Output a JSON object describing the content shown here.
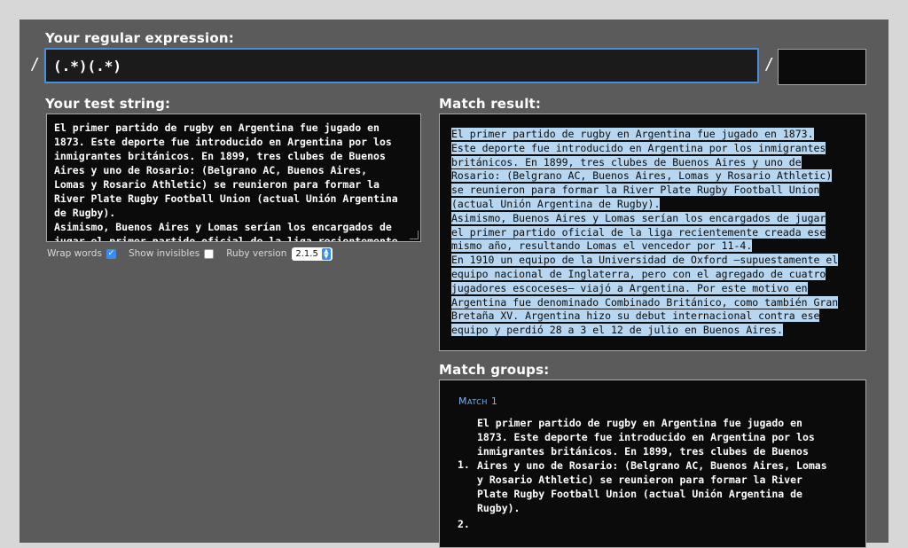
{
  "labels": {
    "regex": "Your regular expression:",
    "test": "Your test string:",
    "result": "Match result:",
    "groups": "Match groups:"
  },
  "regex": {
    "open_slash": "/",
    "close_slash": "/",
    "value": "(.*)(.*)",
    "flags": ""
  },
  "test_string": "El primer partido de rugby en Argentina fue jugado en\n1873. Este deporte fue introducido en Argentina por los\ninmigrantes británicos. En 1899, tres clubes de Buenos\nAires y uno de Rosario: (Belgrano AC, Buenos Aires,\nLomas y Rosario Athletic) se reunieron para formar la\nRiver Plate Rugby Football Union (actual Unión Argentina\nde Rugby).\nAsimismo, Buenos Aires y Lomas serían los encargados de\njugar el primer partido oficial de la liga recientemente",
  "options": {
    "wrap_words": "Wrap words",
    "wrap_words_checked": true,
    "show_invisibles": "Show invisibles",
    "show_invisibles_checked": false,
    "ruby_version_label": "Ruby version",
    "ruby_version": "2.1.5"
  },
  "match_result": [
    "El primer partido de rugby en Argentina fue jugado en 1873.",
    "Este deporte fue introducido en Argentina por los inmigrantes",
    "británicos. En 1899, tres clubes de Buenos Aires y uno de",
    "Rosario: (Belgrano AC, Buenos Aires, Lomas y Rosario Athletic)",
    "se reunieron para formar la River Plate Rugby Football Union",
    "(actual Unión Argentina de Rugby).",
    "Asimismo, Buenos Aires y Lomas serían los encargados de jugar",
    "el primer partido oficial de la liga recientemente creada ese",
    "mismo año, resultando Lomas el vencedor por 11-4.",
    "En 1910 un equipo de la Universidad de Oxford —supuestamente el",
    "equipo nacional de Inglaterra, pero con el agregado de cuatro",
    "jugadores escoceses— viajó a Argentina. Por este motivo en",
    "Argentina fue denominado Combinado Británico, como también Gran",
    "Bretaña XV. Argentina hizo su debut internacional contra ese",
    "equipo y perdió 28 a 3 el 12 de julio en Buenos Aires."
  ],
  "match_groups": {
    "match_title": "Match 1",
    "groups": [
      {
        "num": "1.",
        "value": "El primer partido de rugby en Argentina fue jugado en\n1873. Este deporte fue introducido en Argentina por los\ninmigrantes británicos. En 1899, tres clubes de Buenos\nAires y uno de Rosario: (Belgrano AC, Buenos Aires, Lomas\ny Rosario Athletic) se reunieron para formar la River\nPlate Rugby Football Union (actual Unión Argentina de\nRugby)."
      },
      {
        "num": "2.",
        "value": ""
      }
    ]
  },
  "colors": {
    "accent": "#4a90d9",
    "highlight": "#b6d6f2",
    "background": "#5b5b5b"
  }
}
